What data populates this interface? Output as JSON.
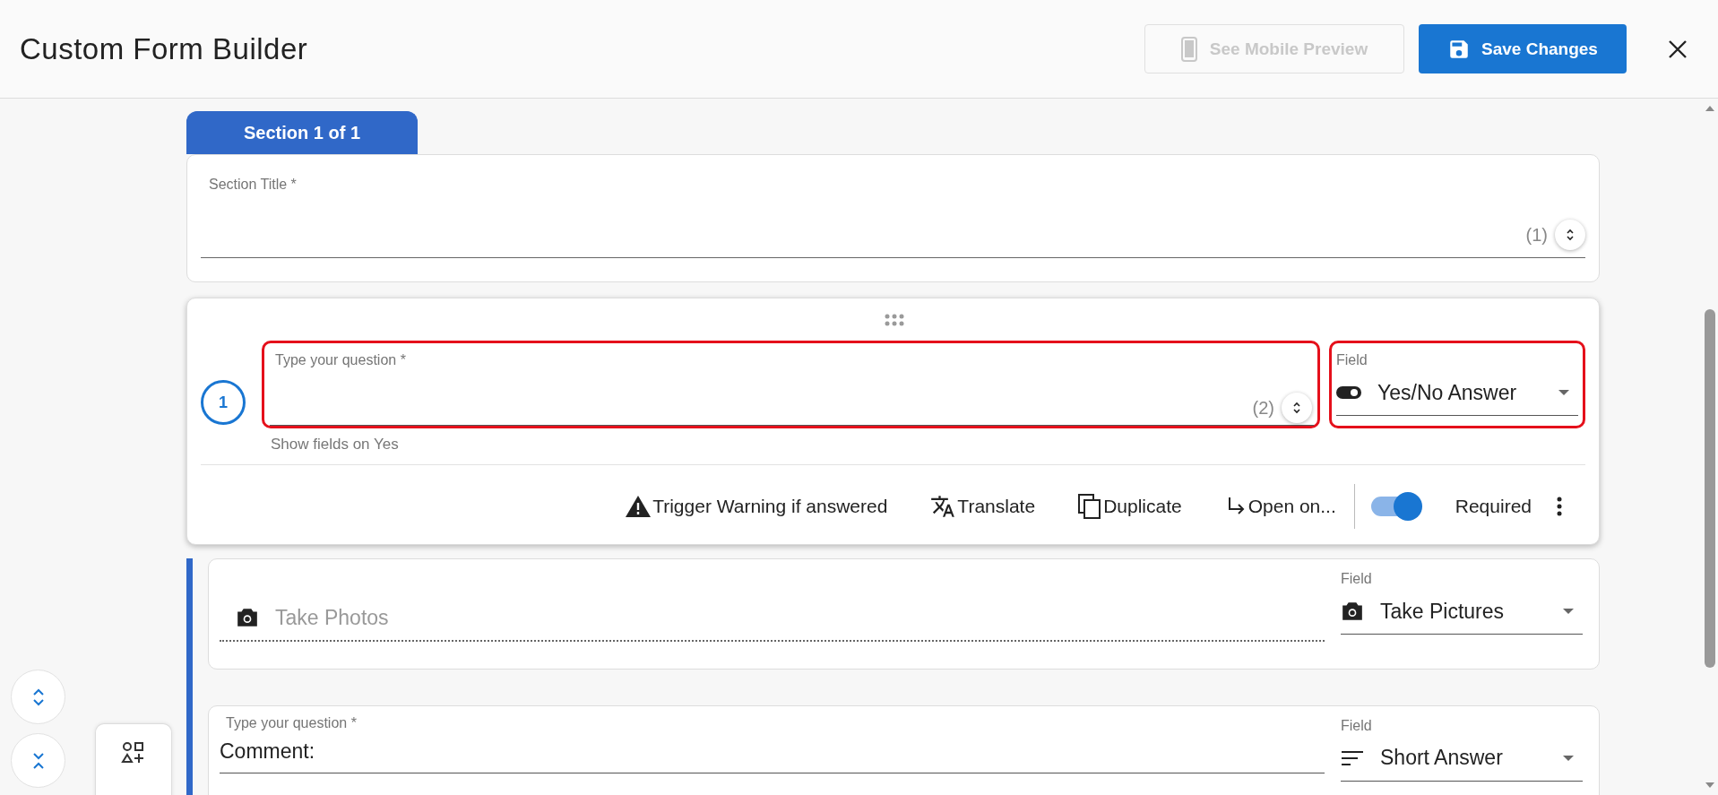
{
  "header": {
    "title": "Custom Form Builder",
    "preview_button": {
      "label": "See Mobile Preview",
      "disabled": true
    },
    "save_button": {
      "label": "Save Changes",
      "disabled": false
    }
  },
  "section_tab": {
    "label": "Section 1 of 1",
    "selected": true
  },
  "section_title": {
    "label": "Section Title *",
    "counter": "(1)"
  },
  "question": {
    "number": "1",
    "label": "Type your question *",
    "counter": "(2)",
    "highlighted": true,
    "hint": "Show fields on Yes",
    "field": {
      "label": "Field",
      "value": "Yes/No Answer",
      "kind": "toggle",
      "highlighted": true
    },
    "actions": [
      {
        "kind": "warning",
        "label": "Trigger Warning if answered"
      },
      {
        "kind": "translate",
        "label": "Translate"
      },
      {
        "kind": "duplicate",
        "label": "Duplicate"
      },
      {
        "kind": "open",
        "label": "Open on..."
      }
    ],
    "required": {
      "label": "Required",
      "on": true
    }
  },
  "sub_questions": [
    {
      "kind": "photo",
      "placeholder": "Take Photos",
      "field": {
        "label": "Field",
        "value": "Take Pictures",
        "kind": "camera"
      }
    },
    {
      "kind": "text",
      "label": "Type your question *",
      "value": "Comment:",
      "field": {
        "label": "Field",
        "value": "Short Answer",
        "kind": "short"
      }
    }
  ]
}
